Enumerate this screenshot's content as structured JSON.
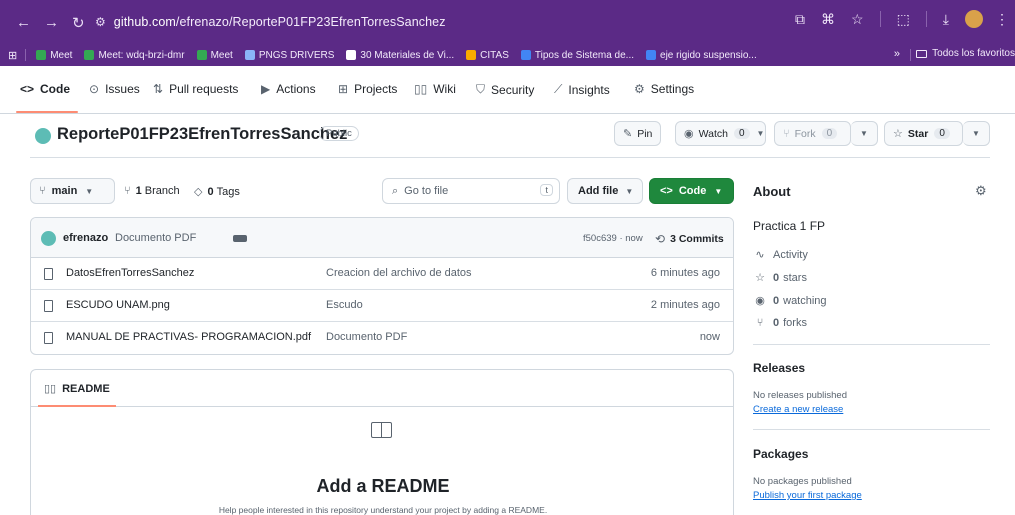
{
  "browser": {
    "url_host": "github.com",
    "url_path": "/efrenazo/ReporteP01FP23EfrenTorresSanchez",
    "bookmarks": [
      {
        "label": "Meet",
        "color": "#34a853"
      },
      {
        "label": "Meet: wdq-brzi-dmr",
        "color": "#34a853"
      },
      {
        "label": "Meet",
        "color": "#34a853"
      },
      {
        "label": "PNGS DRIVERS",
        "color": "#8ab4f8"
      },
      {
        "label": "30 Materiales de Vi...",
        "color": "#ffffff"
      },
      {
        "label": "CITAS",
        "color": "#f9ab00"
      },
      {
        "label": "Tipos de Sistema de...",
        "color": "#4285f4"
      },
      {
        "label": "eje rigido suspensio...",
        "color": "#4285f4"
      }
    ],
    "more_label": "»",
    "all_bookmarks_label": "Todos los favoritos"
  },
  "repo_nav": {
    "tabs": [
      {
        "label": "Code",
        "icon": "code-icon",
        "glyph": "<>"
      },
      {
        "label": "Issues",
        "icon": "issue-icon",
        "glyph": "⊙"
      },
      {
        "label": "Pull requests",
        "icon": "pull-request-icon",
        "glyph": "⇅"
      },
      {
        "label": "Actions",
        "icon": "play-icon",
        "glyph": "▶"
      },
      {
        "label": "Projects",
        "icon": "table-icon",
        "glyph": "⊞"
      },
      {
        "label": "Wiki",
        "icon": "book-icon",
        "glyph": "▯▯"
      },
      {
        "label": "Security",
        "icon": "shield-icon",
        "glyph": "⛉"
      },
      {
        "label": "Insights",
        "icon": "graph-icon",
        "glyph": "⟋"
      },
      {
        "label": "Settings",
        "icon": "gear-icon",
        "glyph": "⚙"
      }
    ]
  },
  "repo": {
    "name": "ReporteP01FP23EfrenTorresSanchez",
    "visibility": "Public",
    "pin_label": "Pin",
    "watch_label": "Watch",
    "watch_count": "0",
    "fork_label": "Fork",
    "fork_count": "0",
    "star_label": "Star",
    "star_count": "0"
  },
  "toolbar": {
    "branch": "main",
    "branches_count": "1",
    "branches_label": "Branch",
    "tags_count": "0",
    "tags_label": "Tags",
    "goto_placeholder": "Go to file",
    "goto_key": "t",
    "add_file_label": "Add file",
    "code_label": "Code"
  },
  "latest_commit": {
    "author": "efrenazo",
    "message": "Documento PDF",
    "hash": "f50c639",
    "time": "now",
    "commits_count": "3",
    "commits_label": "Commits"
  },
  "files": [
    {
      "name": "DatosEfrenTorresSanchez",
      "commit": "Creacion del archivo de datos",
      "time": "6 minutes ago"
    },
    {
      "name": "ESCUDO UNAM.png",
      "commit": "Escudo",
      "time": "2 minutes ago"
    },
    {
      "name": "MANUAL DE PRACTIVAS- PROGRAMACION.pdf",
      "commit": "Documento PDF",
      "time": "now"
    }
  ],
  "readme": {
    "tab_label": "README",
    "title": "Add a README",
    "subtitle": "Help people interested in this repository understand your project by adding a README."
  },
  "sidebar": {
    "about_title": "About",
    "description": "Practica 1 FP",
    "activity_label": "Activity",
    "stars_count": "0",
    "stars_label": "stars",
    "watching_count": "0",
    "watching_label": "watching",
    "forks_count": "0",
    "forks_label": "forks",
    "releases_title": "Releases",
    "releases_none": "No releases published",
    "releases_link": "Create a new release",
    "packages_title": "Packages",
    "packages_none": "No packages published",
    "packages_link": "Publish your first package"
  }
}
